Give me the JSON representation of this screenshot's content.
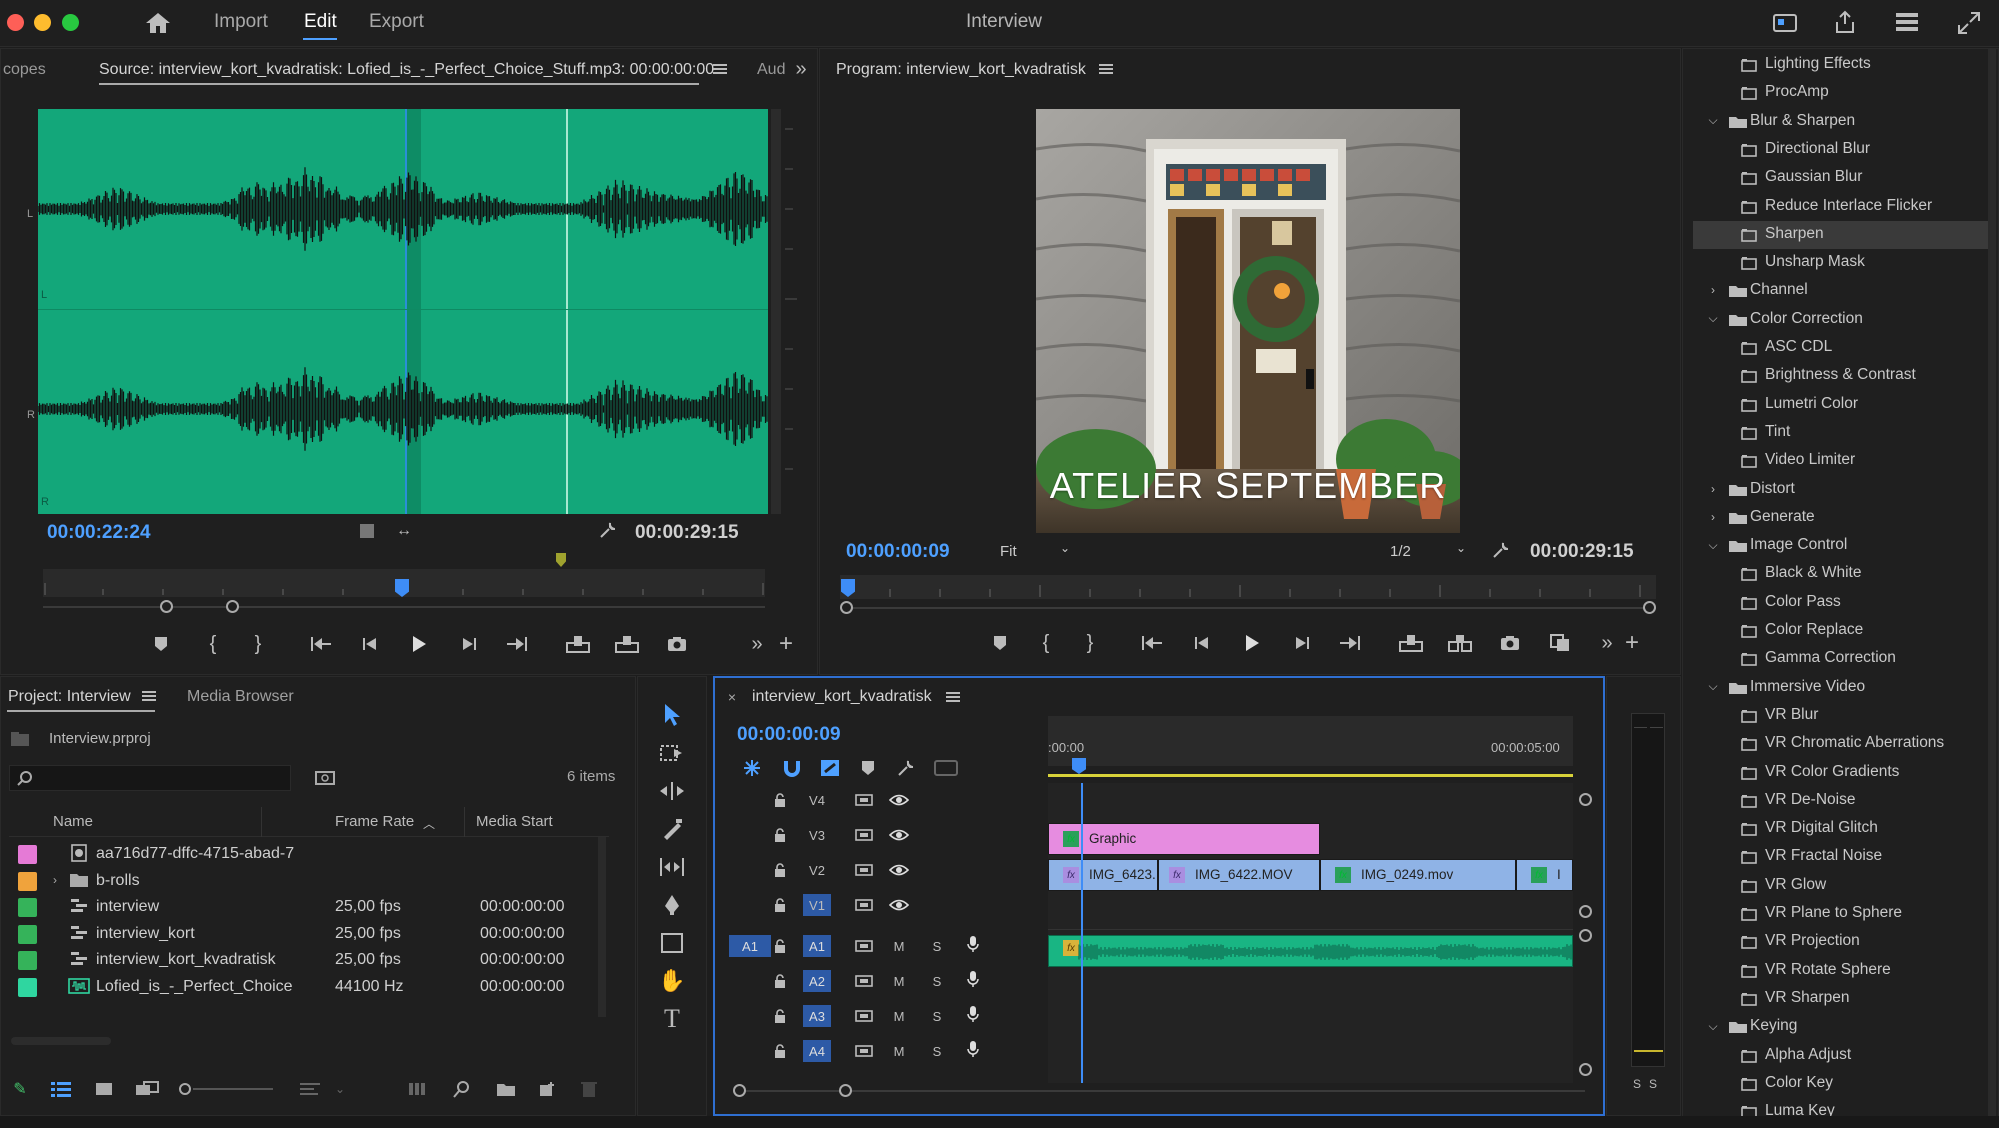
{
  "app": {
    "title": "Interview",
    "nav": [
      "Import",
      "Edit",
      "Export"
    ],
    "active_nav": "Edit"
  },
  "source_panel": {
    "left_tab": "copes",
    "title": "Source: interview_kort_kvadratisk: Lofied_is_-_Perfect_Choice_Stuff.mp3: 00:00:00:00",
    "right_tab": "Aud",
    "timecode_current": "00:00:22:24",
    "timecode_duration": "00:00:29:15",
    "channel_labels": [
      "L",
      "L",
      "R",
      "R"
    ]
  },
  "program_panel": {
    "title": "Program: interview_kort_kvadratisk",
    "overlay_text": "ATELIER SEPTEMBER",
    "timecode_current": "00:00:00:09",
    "fit_value": "Fit",
    "resolution_value": "1/2",
    "timecode_duration": "00:00:29:15"
  },
  "project_panel": {
    "tab_active": "Project: Interview",
    "tab_other": "Media Browser",
    "file_name": "Interview.prproj",
    "item_count": "6 items",
    "search_placeholder": "",
    "columns": [
      "Name",
      "Frame Rate",
      "Media Start"
    ],
    "rows": [
      {
        "color": "#e57ad6",
        "icon": "graphic-icon",
        "name": "aa716d77-dffc-4715-abad-7",
        "rate": "",
        "start": ""
      },
      {
        "color": "#f0a33c",
        "icon": "folder-icon",
        "name": "b-rolls",
        "rate": "",
        "start": ""
      },
      {
        "color": "#35b35a",
        "icon": "sequence-icon",
        "name": "interview",
        "rate": "25,00 fps",
        "start": "00:00:00:00"
      },
      {
        "color": "#35b35a",
        "icon": "sequence-icon",
        "name": "interview_kort",
        "rate": "25,00 fps",
        "start": "00:00:00:00"
      },
      {
        "color": "#35b35a",
        "icon": "sequence-icon",
        "name": "interview_kort_kvadratisk",
        "rate": "25,00 fps",
        "start": "00:00:00:00"
      },
      {
        "color": "#2fd6a0",
        "icon": "audio-file-icon",
        "name": "Lofied_is_-_Perfect_Choice",
        "rate": "44100 Hz",
        "start": "00:00:00:00"
      }
    ]
  },
  "timeline": {
    "sequence_name": "interview_kort_kvadratisk",
    "timecode": "00:00:00:09",
    "ruler_start": ":00:00",
    "ruler_mid": "00:00:05:00",
    "video_tracks": [
      "V4",
      "V3",
      "V2",
      "V1"
    ],
    "audio_tracks": [
      "A1",
      "A2",
      "A3",
      "A4"
    ],
    "source_patch": "A1",
    "clips": {
      "graphic": "Graphic",
      "v2": [
        "IMG_6423.",
        "IMG_6422.MOV",
        "IMG_0249.mov",
        "I"
      ]
    },
    "track_letters": {
      "mute": "M",
      "solo": "S"
    },
    "meter_labels": [
      "S",
      "S"
    ]
  },
  "effects_panel": {
    "items": [
      {
        "type": "effect",
        "label": "Lighting Effects"
      },
      {
        "type": "effect",
        "label": "ProcAmp"
      },
      {
        "type": "folder-open",
        "label": "Blur & Sharpen"
      },
      {
        "type": "effect",
        "label": "Directional Blur"
      },
      {
        "type": "effect",
        "label": "Gaussian Blur"
      },
      {
        "type": "effect",
        "label": "Reduce Interlace Flicker"
      },
      {
        "type": "effect",
        "label": "Sharpen",
        "selected": true
      },
      {
        "type": "effect",
        "label": "Unsharp Mask"
      },
      {
        "type": "folder-closed",
        "label": "Channel"
      },
      {
        "type": "folder-open",
        "label": "Color Correction"
      },
      {
        "type": "effect",
        "label": "ASC CDL"
      },
      {
        "type": "effect",
        "label": "Brightness & Contrast"
      },
      {
        "type": "effect",
        "label": "Lumetri Color"
      },
      {
        "type": "effect",
        "label": "Tint"
      },
      {
        "type": "effect",
        "label": "Video Limiter"
      },
      {
        "type": "folder-closed",
        "label": "Distort"
      },
      {
        "type": "folder-closed",
        "label": "Generate"
      },
      {
        "type": "folder-open",
        "label": "Image Control"
      },
      {
        "type": "effect",
        "label": "Black & White"
      },
      {
        "type": "effect",
        "label": "Color Pass"
      },
      {
        "type": "effect",
        "label": "Color Replace"
      },
      {
        "type": "effect",
        "label": "Gamma Correction"
      },
      {
        "type": "folder-open",
        "label": "Immersive Video"
      },
      {
        "type": "effect",
        "label": "VR Blur"
      },
      {
        "type": "effect",
        "label": "VR Chromatic Aberrations"
      },
      {
        "type": "effect",
        "label": "VR Color Gradients"
      },
      {
        "type": "effect",
        "label": "VR De-Noise"
      },
      {
        "type": "effect",
        "label": "VR Digital Glitch"
      },
      {
        "type": "effect",
        "label": "VR Fractal Noise"
      },
      {
        "type": "effect",
        "label": "VR Glow"
      },
      {
        "type": "effect",
        "label": "VR Plane to Sphere"
      },
      {
        "type": "effect",
        "label": "VR Projection"
      },
      {
        "type": "effect",
        "label": "VR Rotate Sphere"
      },
      {
        "type": "effect",
        "label": "VR Sharpen"
      },
      {
        "type": "folder-open",
        "label": "Keying"
      },
      {
        "type": "effect",
        "label": "Alpha Adjust"
      },
      {
        "type": "effect",
        "label": "Color Key"
      },
      {
        "type": "effect",
        "label": "Luma Key"
      }
    ]
  },
  "colors": {
    "accent_blue": "#4ea0ff",
    "waveform_bg": "#13a77a",
    "graphic_clip": "#e68ce0",
    "video_clip": "#8fb3e6",
    "audio_clip": "#19b583",
    "panel_focus": "#2f6fd1"
  }
}
